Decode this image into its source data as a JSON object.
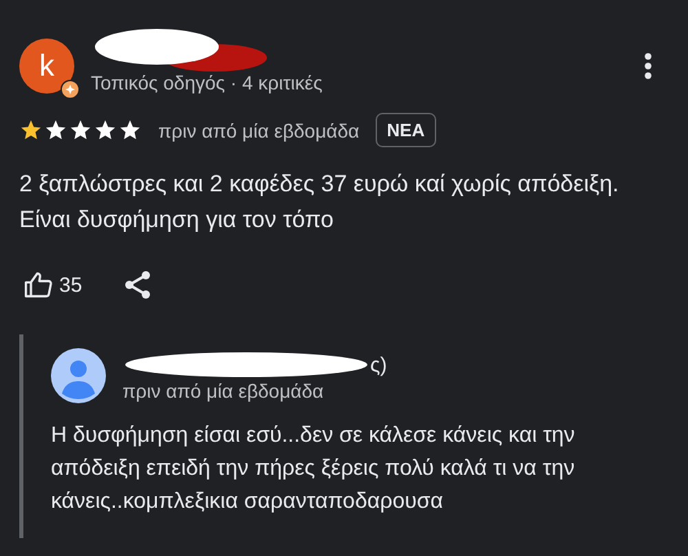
{
  "review": {
    "avatar_initial": "k",
    "author_subtitle": "Τοπικός οδηγός · 4 κριτικές",
    "stars": 1,
    "time": "πριν από μία εβδομάδα",
    "badge": "ΝΕΑ",
    "text": "2 ξαπλώστρες και 2 καφέδες 37 ευρώ καί χωρίς απόδειξη. Είναι δυσφήμηση για τον τόπο",
    "likes": "35"
  },
  "reply": {
    "author_visible": "ς)",
    "time": "πριν από μία εβδομάδα",
    "text": "Η δυσφήμηση είσαι εσύ...δεν σε κάλεσε κάνεις και την απόδειξη επειδή την πήρες ξέρεις πολύ καλά τι να την κάνεις..κομπλεξικια σαρανταποδαρουσα"
  }
}
